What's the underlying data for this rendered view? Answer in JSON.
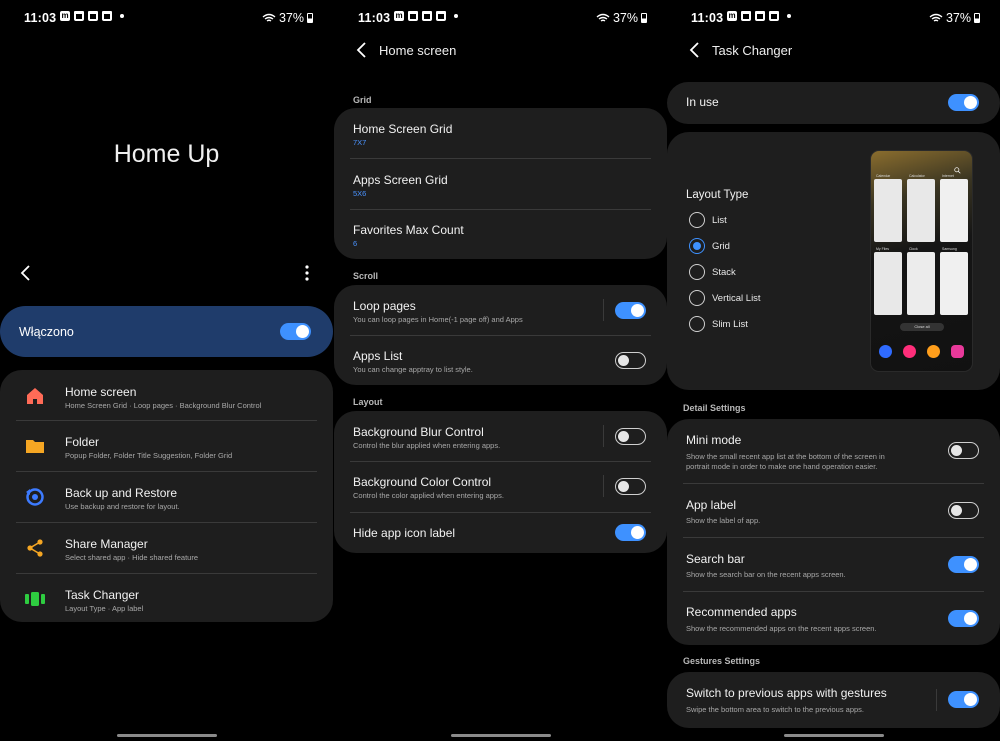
{
  "status": {
    "time": "11:03",
    "battery": "37%"
  },
  "panel1": {
    "app_title": "Home Up",
    "master": {
      "label": "Włączono",
      "on": true
    },
    "items": [
      {
        "title": "Home screen",
        "subtitle": "Home Screen Grid · Loop pages · Background Blur Control",
        "icon": "home-icon",
        "color": "#ff6b57"
      },
      {
        "title": "Folder",
        "subtitle": "Popup Folder, Folder Title Suggestion, Folder Grid",
        "icon": "folder-icon",
        "color": "#f5a623"
      },
      {
        "title": "Back up and Restore",
        "subtitle": "Use backup and restore for layout.",
        "icon": "backup-icon",
        "color": "#3d7bff"
      },
      {
        "title": "Share Manager",
        "subtitle": "Select shared app · Hide shared feature",
        "icon": "share-icon",
        "color": "#f5a623"
      },
      {
        "title": "Task Changer",
        "subtitle": "Layout Type · App label",
        "icon": "task-changer-icon",
        "color": "#2ecc40"
      }
    ]
  },
  "panel2": {
    "title": "Home screen",
    "sections": {
      "grid": "Grid",
      "scroll": "Scroll",
      "layout": "Layout"
    },
    "grid_items": [
      {
        "title": "Home Screen Grid",
        "value": "7X7"
      },
      {
        "title": "Apps Screen Grid",
        "value": "5X6"
      },
      {
        "title": "Favorites Max Count",
        "value": "6"
      }
    ],
    "scroll_items": [
      {
        "title": "Loop pages",
        "subtitle": "You can loop pages in Home(-1 page off) and Apps",
        "on": true
      },
      {
        "title": "Apps List",
        "subtitle": "You can change apptray to list style.",
        "on": false
      }
    ],
    "layout_items": [
      {
        "title": "Background Blur Control",
        "subtitle": "Control the blur applied when entering apps.",
        "on": false
      },
      {
        "title": "Background Color Control",
        "subtitle": "Control the color applied when entering apps.",
        "on": false
      },
      {
        "title": "Hide app icon label",
        "subtitle": "",
        "on": true
      }
    ]
  },
  "panel3": {
    "title": "Task Changer",
    "in_use": {
      "label": "In use",
      "on": true
    },
    "layout_type": {
      "label": "Layout Type",
      "options": [
        "List",
        "Grid",
        "Stack",
        "Vertical List",
        "Slim List"
      ],
      "selected": "Grid"
    },
    "preview": {
      "close_all": "Close all",
      "apps": [
        "Calendar",
        "Calculator",
        "Internet",
        "My Files",
        "Clock",
        "Samsung"
      ]
    },
    "detail_label": "Detail Settings",
    "details": [
      {
        "title": "Mini mode",
        "subtitle": "Show the small recent app list at the bottom of the screen in",
        "subtitle2": "portrait mode in order to make one hand operation easier.",
        "on": false
      },
      {
        "title": "App label",
        "subtitle": "Show the label of app.",
        "on": false
      },
      {
        "title": "Search bar",
        "subtitle": "Show the search bar on the recent apps screen.",
        "on": true
      },
      {
        "title": "Recommended apps",
        "subtitle": "Show the recommended apps on the recent apps screen.",
        "on": true
      }
    ],
    "gestures_label": "Gestures Settings",
    "gesture": {
      "title": "Switch to previous apps with gestures",
      "subtitle": "Swipe the bottom area to switch to the previous apps.",
      "on": true
    }
  }
}
